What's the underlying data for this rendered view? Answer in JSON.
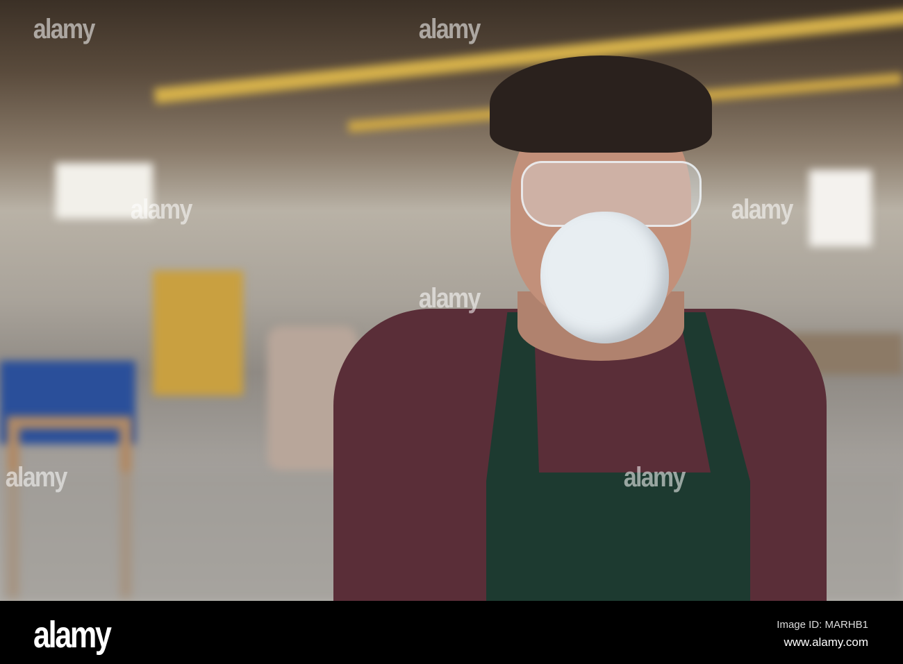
{
  "watermark": {
    "text": "alamy"
  },
  "footer": {
    "logo": "alamy",
    "image_id": "Image ID: MARHB1",
    "url": "www.alamy.com"
  },
  "colors": {
    "shirt": "#5a2e38",
    "apron": "#1d3a30",
    "mask": "#e8eef2",
    "footer_bg": "#000000"
  }
}
